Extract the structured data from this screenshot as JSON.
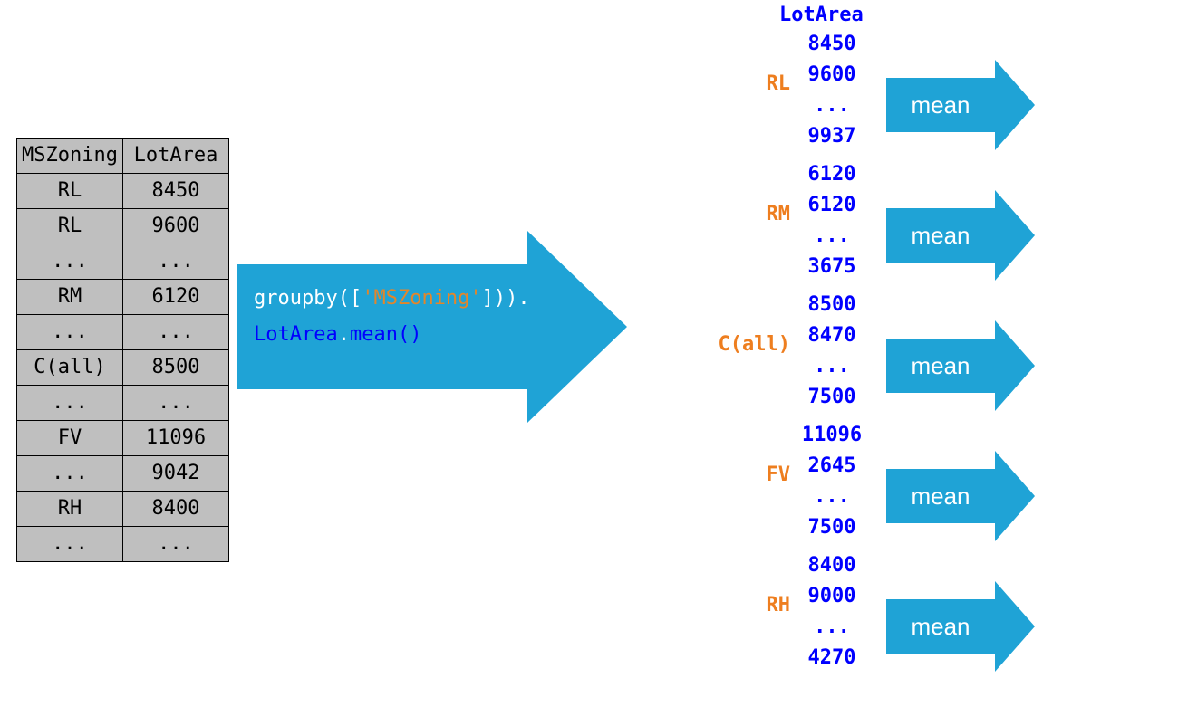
{
  "table": {
    "headers": [
      "MSZoning",
      "LotArea"
    ],
    "rows": [
      [
        "RL",
        "8450"
      ],
      [
        "RL",
        "9600"
      ],
      [
        "...",
        "..."
      ],
      [
        "RM",
        "6120"
      ],
      [
        "...",
        "..."
      ],
      [
        "C(all)",
        "8500"
      ],
      [
        "...",
        "..."
      ],
      [
        "FV",
        "11096"
      ],
      [
        "...",
        "9042"
      ],
      [
        "RH",
        "8400"
      ],
      [
        "...",
        "..."
      ]
    ]
  },
  "code": {
    "t_groupby": "groupby([",
    "t_arg": "'MSZoning'",
    "t_close": "])).",
    "t_col": "LotArea",
    "t_dot": ".",
    "t_mean": "mean()"
  },
  "groups_header": "LotArea",
  "mean_label": "mean",
  "groups": [
    {
      "name": "RL",
      "values": [
        "8450",
        "9600",
        "...",
        "9937"
      ]
    },
    {
      "name": "RM",
      "values": [
        "6120",
        "6120",
        "...",
        "3675"
      ]
    },
    {
      "name": "C(all)",
      "values": [
        "8500",
        "8470",
        "...",
        "7500"
      ]
    },
    {
      "name": "FV",
      "values": [
        "11096",
        "2645",
        "...",
        "7500"
      ]
    },
    {
      "name": "RH",
      "values": [
        "8400",
        "9000",
        "...",
        "4270"
      ]
    }
  ]
}
